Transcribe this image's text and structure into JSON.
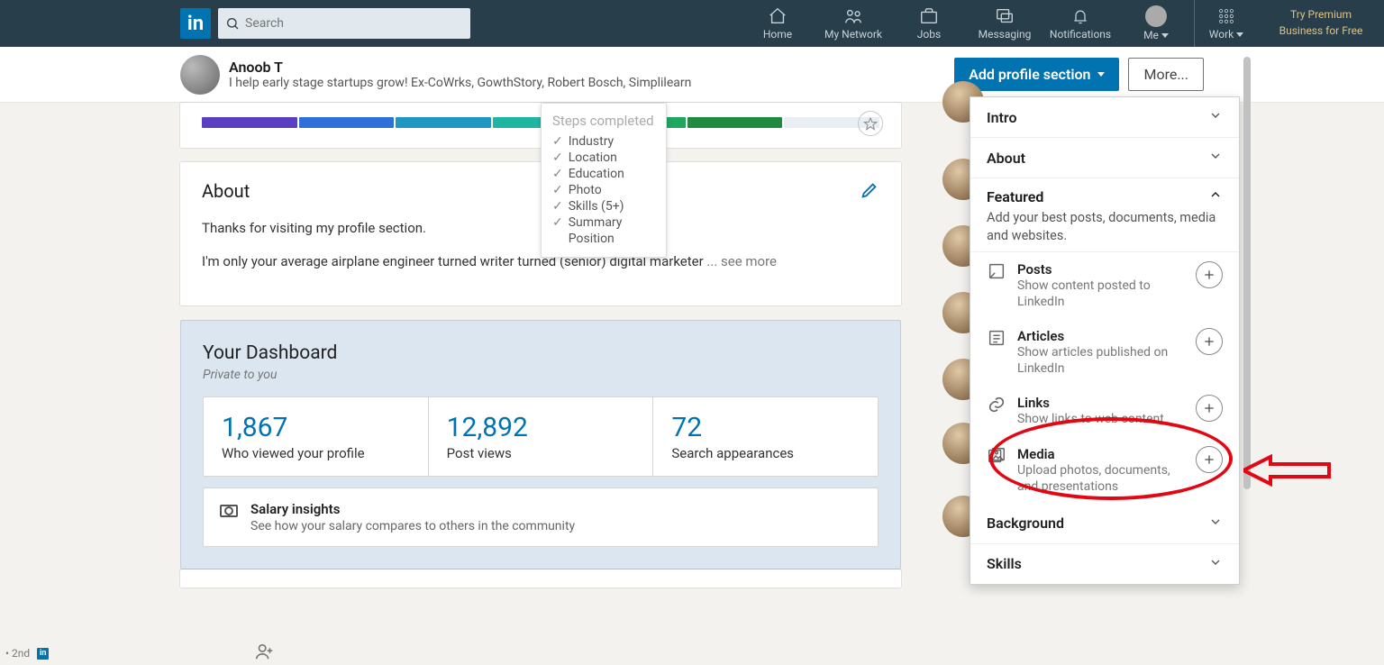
{
  "nav": {
    "search_placeholder": "Search",
    "items": {
      "home": "Home",
      "network": "My Network",
      "jobs": "Jobs",
      "messaging": "Messaging",
      "notifications": "Notifications",
      "me": "Me",
      "work": "Work"
    },
    "premium_line1": "Try Premium",
    "premium_line2": "Business for Free"
  },
  "subhead": {
    "name": "Anoob T",
    "tagline": "I help early stage startups grow! Ex-CoWrks, GowthStory, Robert Bosch, Simplilearn",
    "add_btn": "Add profile section",
    "more_btn": "More..."
  },
  "strength": {
    "segments": [
      {
        "color": "#5a3fc0"
      },
      {
        "color": "#2e6fd9"
      },
      {
        "color": "#1f97c1"
      },
      {
        "color": "#1fb5a0"
      },
      {
        "color": "#1fa65f"
      },
      {
        "color": "#1f8b3f"
      },
      {
        "color": "#e9eef2"
      }
    ]
  },
  "steps": {
    "title": "Steps completed",
    "items": [
      {
        "label": "Industry",
        "done": true
      },
      {
        "label": "Location",
        "done": true
      },
      {
        "label": "Education",
        "done": true
      },
      {
        "label": "Photo",
        "done": true
      },
      {
        "label": "Skills (5+)",
        "done": true
      },
      {
        "label": "Summary",
        "done": true
      },
      {
        "label": "Position",
        "done": false
      }
    ]
  },
  "about": {
    "heading": "About",
    "p1": "Thanks for visiting my profile section.",
    "p2": "I'm only your average airplane engineer turned writer turned (senior) digital marketer",
    "see_more": "... see more"
  },
  "dashboard": {
    "heading": "Your Dashboard",
    "sub": "Private to you",
    "stats": [
      {
        "value": "1,867",
        "label": "Who viewed your profile"
      },
      {
        "value": "12,892",
        "label": "Post views"
      },
      {
        "value": "72",
        "label": "Search appearances"
      }
    ],
    "salary_title": "Salary insights",
    "salary_sub": "See how your salary compares to others in the community"
  },
  "panel": {
    "rows": {
      "intro": "Intro",
      "about": "About",
      "featured": "Featured",
      "featured_desc": "Add your best posts, documents, media and websites.",
      "background": "Background",
      "skills": "Skills"
    },
    "featured_items": [
      {
        "title": "Posts",
        "desc": "Show content posted to LinkedIn"
      },
      {
        "title": "Articles",
        "desc": "Show articles published on LinkedIn"
      },
      {
        "title": "Links",
        "desc": "Show links to web content"
      },
      {
        "title": "Media",
        "desc": "Upload photos, documents, and presentations"
      }
    ]
  },
  "rail": {
    "degree": "• 2nd"
  }
}
